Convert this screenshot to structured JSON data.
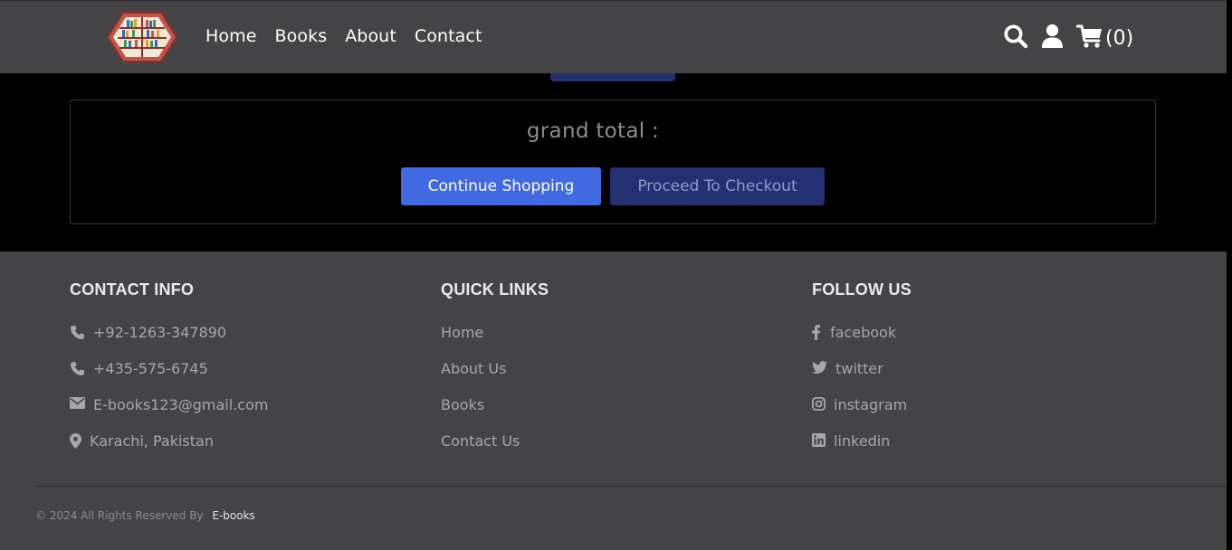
{
  "header": {
    "logo_icon": "bookshelf-logo-icon",
    "nav": [
      "Home",
      "Books",
      "About",
      "Contact"
    ],
    "icons": [
      "search-icon",
      "user-icon",
      "cart-icon"
    ],
    "cart_count": "(0)"
  },
  "summary": {
    "grand_total_label": "grand total :",
    "continue_label": "Continue Shopping",
    "checkout_label": "Proceed To Checkout"
  },
  "footer": {
    "contact": {
      "title": "CONTACT INFO",
      "items": [
        {
          "icon": "phone-icon",
          "text": "+92-1263-347890"
        },
        {
          "icon": "phone-icon",
          "text": "+435-575-6745"
        },
        {
          "icon": "envelope-icon",
          "text": "E-books123@gmail.com"
        },
        {
          "icon": "map-marker-icon",
          "text": "Karachi, Pakistan"
        }
      ]
    },
    "links": {
      "title": "QUICK LINKS",
      "items": [
        "Home",
        "About Us",
        "Books",
        "Contact Us"
      ]
    },
    "follow": {
      "title": "FOLLOW US",
      "items": [
        {
          "icon": "facebook-icon",
          "text": "facebook"
        },
        {
          "icon": "twitter-icon",
          "text": "twitter"
        },
        {
          "icon": "instagram-icon",
          "text": "instagram"
        },
        {
          "icon": "linkedin-icon",
          "text": "linkedin"
        }
      ]
    },
    "copyright": "© 2024 All Rights Reserved By",
    "brand": "E-books"
  },
  "colors": {
    "header_bg": "#444446",
    "band_bg": "#000000",
    "primary_button": "#4169e1",
    "secondary_button": "#233071"
  }
}
